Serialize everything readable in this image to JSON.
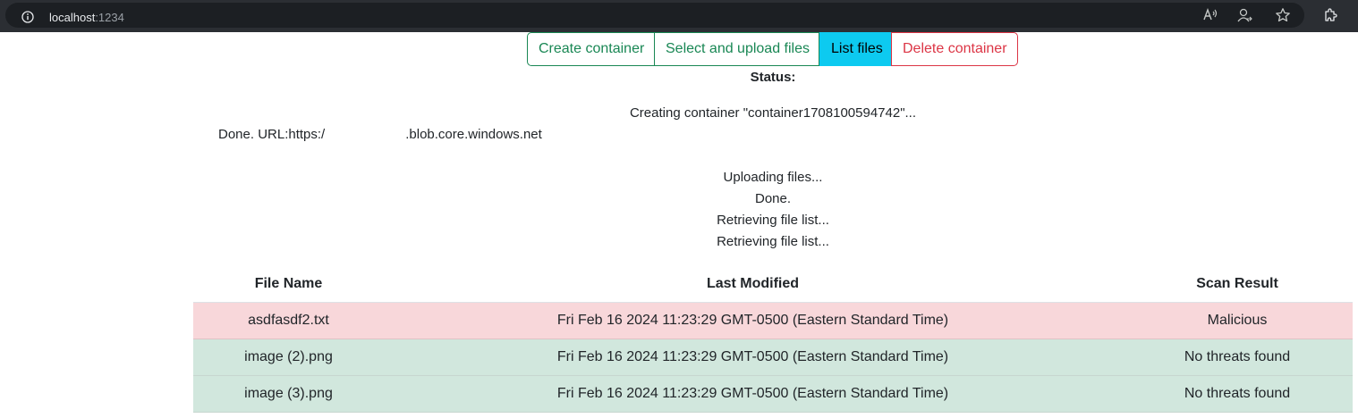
{
  "browser": {
    "url_host": "localhost",
    "url_port": ":1234"
  },
  "toolbar": {
    "create_label": "Create container",
    "upload_label": "Select and upload files",
    "list_label": "List files",
    "delete_label": "Delete container",
    "colors": {
      "success": "#198754",
      "info": "#0dcaf0",
      "danger": "#dc3545"
    }
  },
  "status": {
    "title": "Status:",
    "lines": {
      "creating": "Creating container \"container1708100594742\"...",
      "done_url_prefix": "Done. URL:https:/",
      "done_url_suffix": ".blob.core.windows.net",
      "uploading": "Uploading files...",
      "done": "Done.",
      "retrieving_1": "Retrieving file list...",
      "retrieving_2": "Retrieving file list..."
    }
  },
  "table": {
    "headers": [
      "File Name",
      "Last Modified",
      "Scan Result"
    ],
    "rows": [
      {
        "name": "asdfasdf2.txt",
        "modified": "Fri Feb 16 2024 11:23:29 GMT-0500 (Eastern Standard Time)",
        "result": "Malicious",
        "status": "danger"
      },
      {
        "name": "image (2).png",
        "modified": "Fri Feb 16 2024 11:23:29 GMT-0500 (Eastern Standard Time)",
        "result": "No threats found",
        "status": "success"
      },
      {
        "name": "image (3).png",
        "modified": "Fri Feb 16 2024 11:23:29 GMT-0500 (Eastern Standard Time)",
        "result": "No threats found",
        "status": "success"
      }
    ]
  }
}
